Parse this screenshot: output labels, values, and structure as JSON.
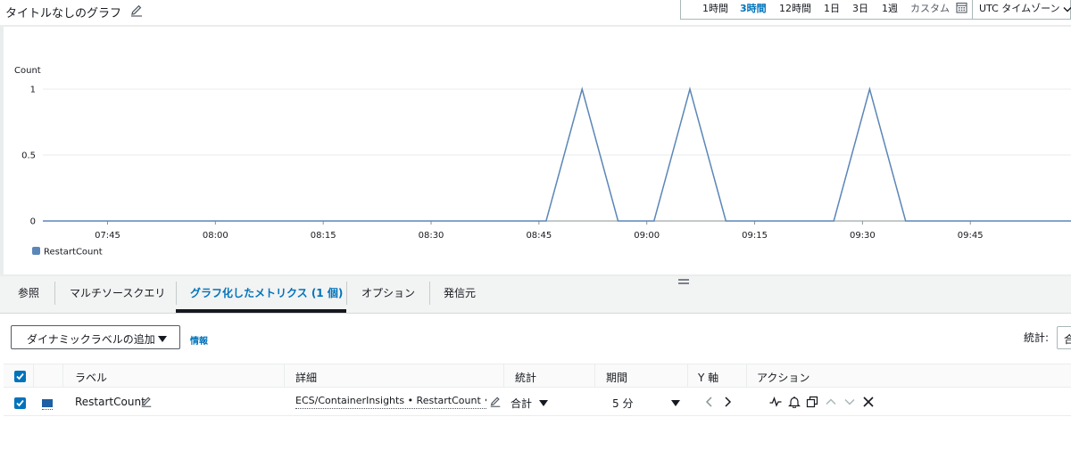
{
  "header": {
    "title": "タイトルなしのグラフ",
    "time_ranges": [
      {
        "label": "1時間",
        "active": false
      },
      {
        "label": "3時間",
        "active": true
      },
      {
        "label": "12時間",
        "active": false
      },
      {
        "label": "1日",
        "active": false
      },
      {
        "label": "3日",
        "active": false
      },
      {
        "label": "1週",
        "active": false
      },
      {
        "label": "カスタム",
        "active": false
      }
    ],
    "timezone": "UTC タイムゾーン"
  },
  "chart_data": {
    "type": "line",
    "ylabel": "Count",
    "ylim": [
      0,
      1
    ],
    "yticks": [
      "0",
      "0.5",
      "1"
    ],
    "xticks": [
      "07:45",
      "08:00",
      "08:15",
      "08:30",
      "08:45",
      "09:00",
      "09:15",
      "09:30",
      "09:45"
    ],
    "xlim": [
      "07:36",
      "09:59"
    ],
    "series": [
      {
        "name": "RestartCount",
        "color": "#5b86b8",
        "points": [
          [
            "07:36",
            0
          ],
          [
            "08:46",
            0
          ],
          [
            "08:51",
            1
          ],
          [
            "08:56",
            0
          ],
          [
            "09:01",
            0
          ],
          [
            "09:06",
            1
          ],
          [
            "09:11",
            0
          ],
          [
            "09:26",
            0
          ],
          [
            "09:31",
            1
          ],
          [
            "09:36",
            0
          ],
          [
            "09:59",
            0
          ]
        ]
      }
    ],
    "legend": "bottom-left",
    "grid": true
  },
  "tabs": [
    {
      "label": "参照",
      "active": false
    },
    {
      "label": "マルチソースクエリ",
      "active": false
    },
    {
      "label": "グラフ化したメトリクス (1 個)",
      "active": true
    },
    {
      "label": "オプション",
      "active": false
    },
    {
      "label": "発信元",
      "active": false
    }
  ],
  "controls": {
    "dynamic_label_button": "ダイナミックラベルの追加",
    "info_link": "情報",
    "statistic_label": "統計:",
    "statistic_value": "合"
  },
  "table": {
    "headers": [
      "ラベル",
      "詳細",
      "統計",
      "期間",
      "Y 軸",
      "アクション"
    ],
    "rows": [
      {
        "checked": true,
        "color": "#1f5fa3",
        "label": "RestartCount",
        "detail": "ECS/ContainerInsights • RestartCount • ServiceName",
        "statistic": "合計",
        "period": "5 分"
      }
    ]
  }
}
